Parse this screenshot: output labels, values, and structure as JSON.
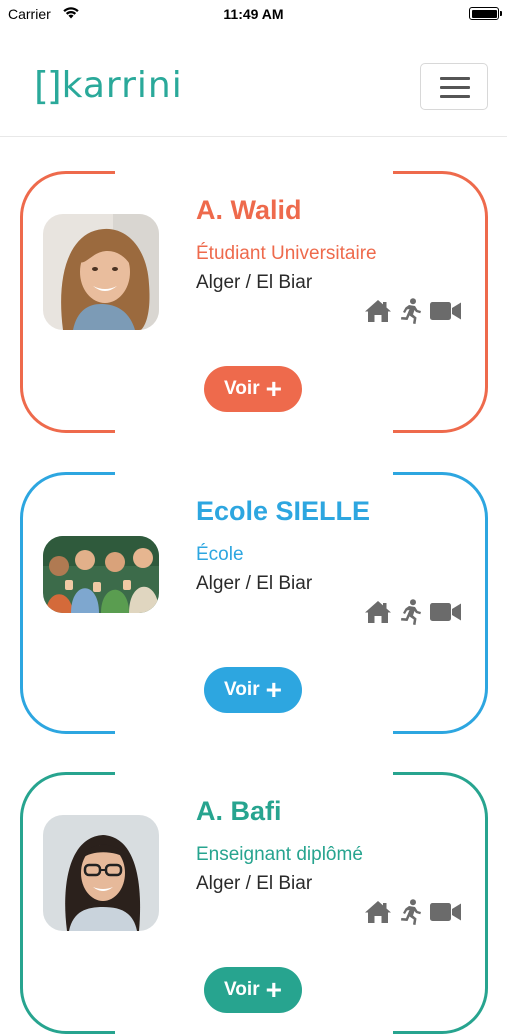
{
  "status_bar": {
    "carrier": "Carrier",
    "time": "11:49 AM"
  },
  "header": {
    "logo_text": "karrini",
    "logo_mark": "[]"
  },
  "colors": {
    "accent": "#2aa99a",
    "orange": "#ee6a4c",
    "blue": "#2da6e0",
    "teal": "#27a48f"
  },
  "cards": [
    {
      "name": "A. Walid",
      "role": "Étudiant Universitaire",
      "location": "Alger / El Biar",
      "button": "Voir",
      "color": "#ee6a4c",
      "icons": [
        "home-icon",
        "running-icon",
        "video-camera-icon"
      ]
    },
    {
      "name": "Ecole SIELLE",
      "role": "École",
      "location": "Alger / El Biar",
      "button": "Voir",
      "color": "#2da6e0",
      "icons": [
        "home-icon",
        "running-icon",
        "video-camera-icon"
      ]
    },
    {
      "name": "A. Bafi",
      "role": "Enseignant diplômé",
      "location": "Alger / El Biar",
      "button": "Voir",
      "color": "#27a48f",
      "icons": [
        "home-icon",
        "running-icon",
        "video-camera-icon"
      ]
    }
  ]
}
